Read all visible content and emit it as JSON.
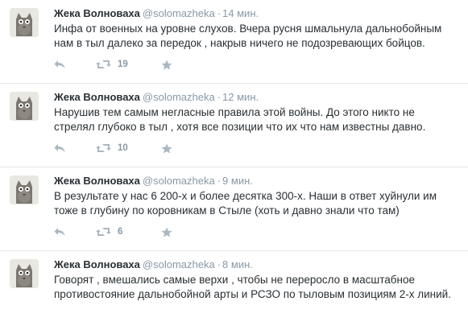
{
  "tweets": [
    {
      "fullname": "Жека Волноваха",
      "username": "@solomazheka",
      "dot": "·",
      "time": "14 мин.",
      "text": "Инфа от военных на уровне слухов. Вчера русня шмальнула дальнобойным нам в тыл далеко за передок , накрыв ничего не подозревающих бойцов.",
      "retweets": "19"
    },
    {
      "fullname": "Жека Волноваха",
      "username": "@solomazheka",
      "dot": "·",
      "time": "12 мин.",
      "text": "Нарушив тем самым негласные правила этой войны. До этого никто не стрелял глубоко в тыл , хотя все позиции что их что нам известны давно.",
      "retweets": "10"
    },
    {
      "fullname": "Жека Волноваха",
      "username": "@solomazheka",
      "dot": "·",
      "time": "9 мин.",
      "text": "В результате у нас 6 200-х и более десятка 300-х. Наши в ответ хуйнули им тоже в глубину по коровникам в Стыле (хоть и давно знали что там)",
      "retweets": "6"
    },
    {
      "fullname": "Жека Волноваха",
      "username": "@solomazheka",
      "dot": "·",
      "time": "8 мин.",
      "text": "Говорят , вмешались самые верхи , чтобы не переросло в масштабное противостояние дальнобойной арты и РСЗО по тыловым позициям 2-х линий."
    }
  ],
  "icons": {
    "avatar": "cat-avatar-icon",
    "reply": "reply-icon",
    "retweet": "retweet-icon",
    "favorite": "star-icon"
  },
  "colors": {
    "name": "#292f33",
    "meta": "#8899a6",
    "action_icon": "#aab8c2",
    "divider": "#e8e8e8"
  }
}
